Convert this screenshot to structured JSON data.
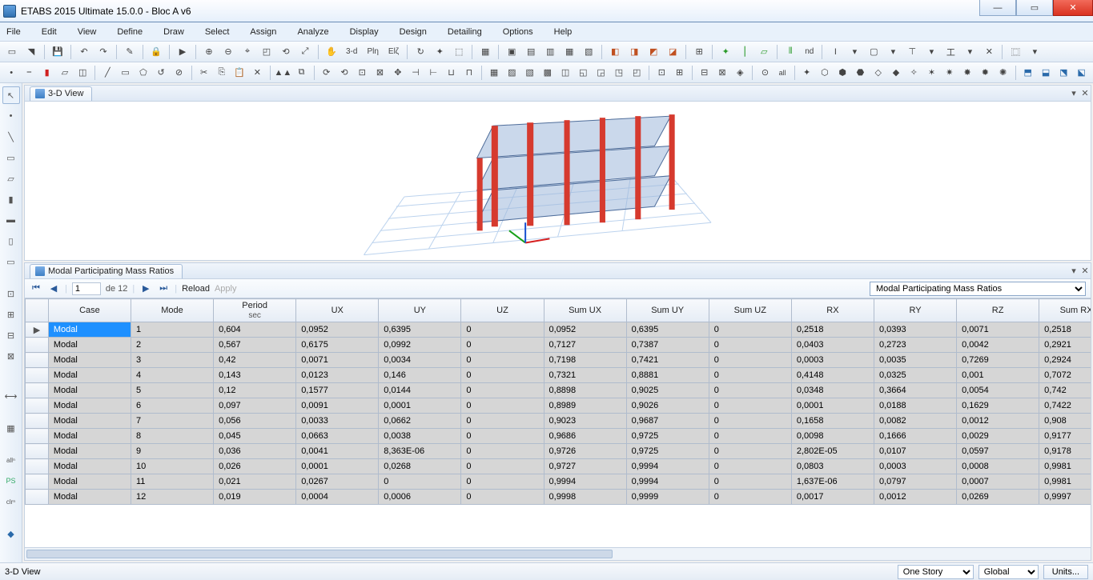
{
  "title": "ETABS 2015 Ultimate 15.0.0 - Bloc A v6",
  "menu": [
    "File",
    "Edit",
    "View",
    "Define",
    "Draw",
    "Select",
    "Assign",
    "Analyze",
    "Display",
    "Design",
    "Detailing",
    "Options",
    "Help"
  ],
  "view3d_tab": "3-D View",
  "table_tab": "Modal Participating Mass Ratios",
  "nav": {
    "page": "1",
    "total_label": "de 12",
    "reload": "Reload",
    "apply": "Apply"
  },
  "combo_value": "Modal Participating Mass Ratios",
  "cols": [
    "Case",
    "Mode",
    "Period sec",
    "UX",
    "UY",
    "UZ",
    "Sum UX",
    "Sum UY",
    "Sum UZ",
    "RX",
    "RY",
    "RZ",
    "Sum RX"
  ],
  "rows": [
    {
      "case": "Modal",
      "mode": "1",
      "period": "0,604",
      "ux": "0,0952",
      "uy": "0,6395",
      "uz": "0",
      "sux": "0,0952",
      "suy": "0,6395",
      "suz": "0",
      "rx": "0,2518",
      "ry": "0,0393",
      "rz": "0,0071",
      "srx": "0,2518"
    },
    {
      "case": "Modal",
      "mode": "2",
      "period": "0,567",
      "ux": "0,6175",
      "uy": "0,0992",
      "uz": "0",
      "sux": "0,7127",
      "suy": "0,7387",
      "suz": "0",
      "rx": "0,0403",
      "ry": "0,2723",
      "rz": "0,0042",
      "srx": "0,2921"
    },
    {
      "case": "Modal",
      "mode": "3",
      "period": "0,42",
      "ux": "0,0071",
      "uy": "0,0034",
      "uz": "0",
      "sux": "0,7198",
      "suy": "0,7421",
      "suz": "0",
      "rx": "0,0003",
      "ry": "0,0035",
      "rz": "0,7269",
      "srx": "0,2924"
    },
    {
      "case": "Modal",
      "mode": "4",
      "period": "0,143",
      "ux": "0,0123",
      "uy": "0,146",
      "uz": "0",
      "sux": "0,7321",
      "suy": "0,8881",
      "suz": "0",
      "rx": "0,4148",
      "ry": "0,0325",
      "rz": "0,001",
      "srx": "0,7072"
    },
    {
      "case": "Modal",
      "mode": "5",
      "period": "0,12",
      "ux": "0,1577",
      "uy": "0,0144",
      "uz": "0",
      "sux": "0,8898",
      "suy": "0,9025",
      "suz": "0",
      "rx": "0,0348",
      "ry": "0,3664",
      "rz": "0,0054",
      "srx": "0,742"
    },
    {
      "case": "Modal",
      "mode": "6",
      "period": "0,097",
      "ux": "0,0091",
      "uy": "0,0001",
      "uz": "0",
      "sux": "0,8989",
      "suy": "0,9026",
      "suz": "0",
      "rx": "0,0001",
      "ry": "0,0188",
      "rz": "0,1629",
      "srx": "0,7422"
    },
    {
      "case": "Modal",
      "mode": "7",
      "period": "0,056",
      "ux": "0,0033",
      "uy": "0,0662",
      "uz": "0",
      "sux": "0,9023",
      "suy": "0,9687",
      "suz": "0",
      "rx": "0,1658",
      "ry": "0,0082",
      "rz": "0,0012",
      "srx": "0,908"
    },
    {
      "case": "Modal",
      "mode": "8",
      "period": "0,045",
      "ux": "0,0663",
      "uy": "0,0038",
      "uz": "0",
      "sux": "0,9686",
      "suy": "0,9725",
      "suz": "0",
      "rx": "0,0098",
      "ry": "0,1666",
      "rz": "0,0029",
      "srx": "0,9177"
    },
    {
      "case": "Modal",
      "mode": "9",
      "period": "0,036",
      "ux": "0,0041",
      "uy": "8,363E-06",
      "uz": "0",
      "sux": "0,9726",
      "suy": "0,9725",
      "suz": "0",
      "rx": "2,802E-05",
      "ry": "0,0107",
      "rz": "0,0597",
      "srx": "0,9178"
    },
    {
      "case": "Modal",
      "mode": "10",
      "period": "0,026",
      "ux": "0,0001",
      "uy": "0,0268",
      "uz": "0",
      "sux": "0,9727",
      "suy": "0,9994",
      "suz": "0",
      "rx": "0,0803",
      "ry": "0,0003",
      "rz": "0,0008",
      "srx": "0,9981"
    },
    {
      "case": "Modal",
      "mode": "11",
      "period": "0,021",
      "ux": "0,0267",
      "uy": "0",
      "uz": "0",
      "sux": "0,9994",
      "suy": "0,9994",
      "suz": "0",
      "rx": "1,637E-06",
      "ry": "0,0797",
      "rz": "0,0007",
      "srx": "0,9981"
    },
    {
      "case": "Modal",
      "mode": "12",
      "period": "0,019",
      "ux": "0,0004",
      "uy": "0,0006",
      "uz": "0",
      "sux": "0,9998",
      "suy": "0,9999",
      "suz": "0",
      "rx": "0,0017",
      "ry": "0,0012",
      "rz": "0,0269",
      "srx": "0,9997"
    }
  ],
  "status": {
    "view": "3-D View",
    "story": "One Story",
    "coord": "Global",
    "units": "Units..."
  },
  "t3d": "3-d",
  "nd_label": "nd"
}
